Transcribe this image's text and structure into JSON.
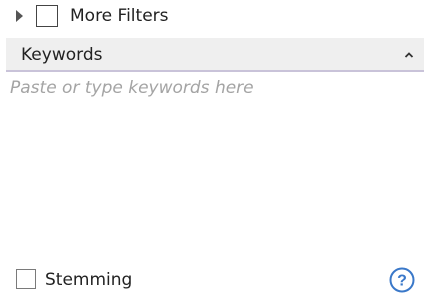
{
  "more_filters": {
    "expand_icon": "triangle-right-icon",
    "checked": false,
    "label": "More Filters"
  },
  "keywords": {
    "title": "Keywords",
    "collapse_icon": "chevron-up-icon",
    "value": "",
    "placeholder": "Paste or type keywords here"
  },
  "stemming": {
    "checked": false,
    "label": "Stemming"
  },
  "help": {
    "icon": "question-circle-icon",
    "glyph": "?",
    "color": "#3a78c9"
  },
  "colors": {
    "header_bg": "#efefef",
    "header_underline": "#c9c3d9",
    "placeholder": "#a4a4a4"
  }
}
